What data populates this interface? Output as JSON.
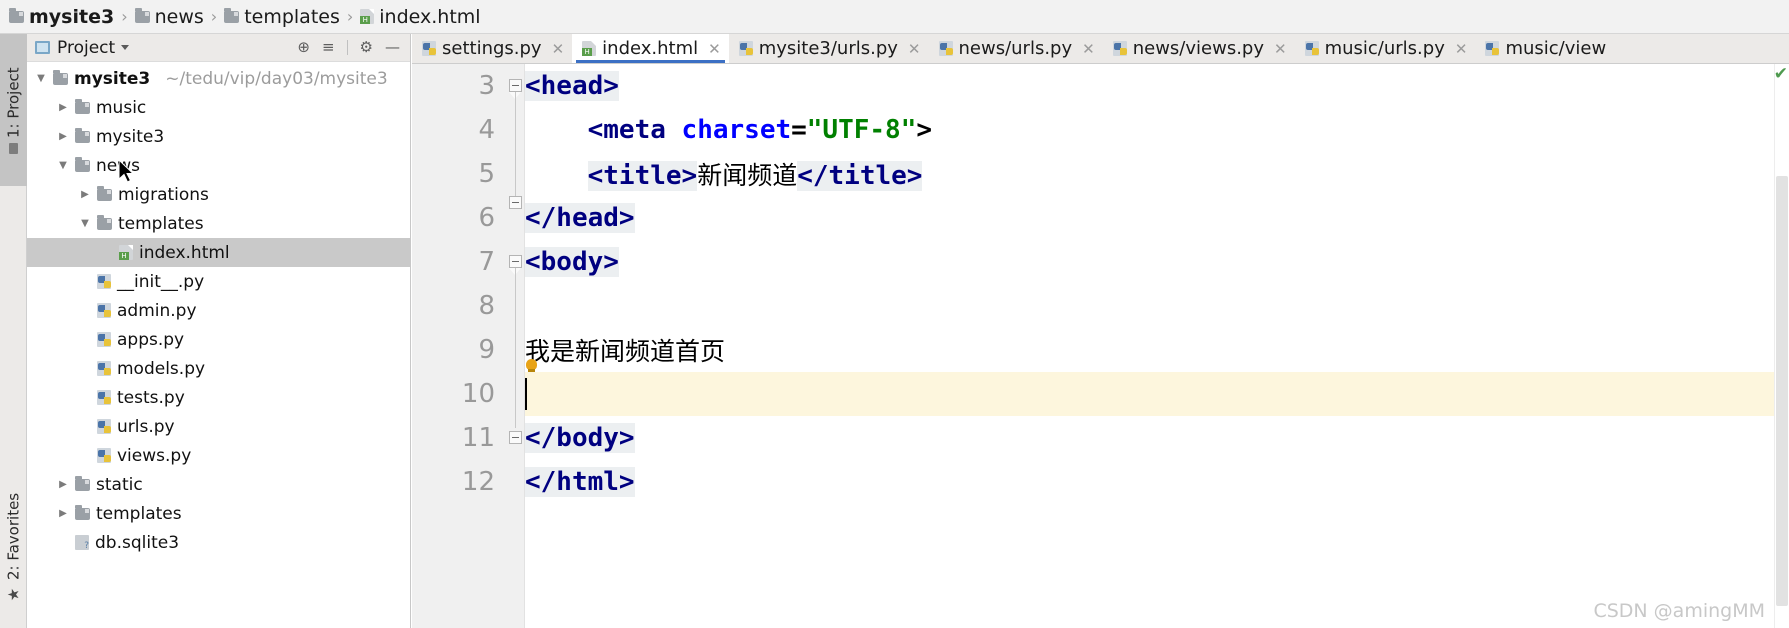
{
  "breadcrumb": {
    "items": [
      {
        "label": "mysite3",
        "icon": "folder-icon",
        "bold": true
      },
      {
        "label": "news",
        "icon": "folder-icon",
        "bold": false
      },
      {
        "label": "templates",
        "icon": "folder-icon",
        "bold": false
      },
      {
        "label": "index.html",
        "icon": "html-file-icon",
        "bold": false
      }
    ],
    "separator": "›"
  },
  "tool_strip": {
    "project_tab": "1: Project",
    "favorites_tab": "2: Favorites"
  },
  "project_panel": {
    "title": "Project",
    "actions": [
      {
        "name": "locate-icon",
        "glyph": "⊕"
      },
      {
        "name": "collapse-all-icon",
        "glyph": "≡"
      },
      {
        "name": "gear-icon",
        "glyph": "⚙"
      },
      {
        "name": "minimize-icon",
        "glyph": "—"
      }
    ],
    "tree": [
      {
        "label": "mysite3",
        "path": "~/tedu/vip/day03/mysite3",
        "icon": "folder-icon",
        "arrow": "expanded",
        "indent": 0,
        "bold": true,
        "selected": false
      },
      {
        "label": "music",
        "path": "",
        "icon": "folder-icon",
        "arrow": "collapsed",
        "indent": 1,
        "bold": false,
        "selected": false
      },
      {
        "label": "mysite3",
        "path": "",
        "icon": "folder-icon",
        "arrow": "collapsed",
        "indent": 1,
        "bold": false,
        "selected": false
      },
      {
        "label": "news",
        "path": "",
        "icon": "folder-icon",
        "arrow": "expanded",
        "indent": 1,
        "bold": false,
        "selected": false
      },
      {
        "label": "migrations",
        "path": "",
        "icon": "folder-icon",
        "arrow": "collapsed",
        "indent": 2,
        "bold": false,
        "selected": false
      },
      {
        "label": "templates",
        "path": "",
        "icon": "folder-icon",
        "arrow": "expanded",
        "indent": 2,
        "bold": false,
        "selected": false
      },
      {
        "label": "index.html",
        "path": "",
        "icon": "html-file-icon",
        "arrow": "none",
        "indent": 3,
        "bold": false,
        "selected": true
      },
      {
        "label": "__init__.py",
        "path": "",
        "icon": "python-file-icon",
        "arrow": "none",
        "indent": 2,
        "bold": false,
        "selected": false
      },
      {
        "label": "admin.py",
        "path": "",
        "icon": "python-file-icon",
        "arrow": "none",
        "indent": 2,
        "bold": false,
        "selected": false
      },
      {
        "label": "apps.py",
        "path": "",
        "icon": "python-file-icon",
        "arrow": "none",
        "indent": 2,
        "bold": false,
        "selected": false
      },
      {
        "label": "models.py",
        "path": "",
        "icon": "python-file-icon",
        "arrow": "none",
        "indent": 2,
        "bold": false,
        "selected": false
      },
      {
        "label": "tests.py",
        "path": "",
        "icon": "python-file-icon",
        "arrow": "none",
        "indent": 2,
        "bold": false,
        "selected": false
      },
      {
        "label": "urls.py",
        "path": "",
        "icon": "python-file-icon",
        "arrow": "none",
        "indent": 2,
        "bold": false,
        "selected": false
      },
      {
        "label": "views.py",
        "path": "",
        "icon": "python-file-icon",
        "arrow": "none",
        "indent": 2,
        "bold": false,
        "selected": false
      },
      {
        "label": "static",
        "path": "",
        "icon": "folder-icon",
        "arrow": "collapsed",
        "indent": 1,
        "bold": false,
        "selected": false
      },
      {
        "label": "templates",
        "path": "",
        "icon": "folder-icon",
        "arrow": "collapsed",
        "indent": 1,
        "bold": false,
        "selected": false
      },
      {
        "label": "db.sqlite3",
        "path": "",
        "icon": "sqlite-file-icon",
        "arrow": "none",
        "indent": 1,
        "bold": false,
        "selected": false
      }
    ]
  },
  "editor_tabs": [
    {
      "label": "settings.py",
      "icon": "python-file-icon",
      "active": false,
      "closable": true
    },
    {
      "label": "index.html",
      "icon": "html-file-icon",
      "active": true,
      "closable": true
    },
    {
      "label": "mysite3/urls.py",
      "icon": "python-file-icon",
      "active": false,
      "closable": true
    },
    {
      "label": "news/urls.py",
      "icon": "python-file-icon",
      "active": false,
      "closable": true
    },
    {
      "label": "news/views.py",
      "icon": "python-file-icon",
      "active": false,
      "closable": true
    },
    {
      "label": "music/urls.py",
      "icon": "python-file-icon",
      "active": false,
      "closable": true
    },
    {
      "label": "music/view",
      "icon": "python-file-icon",
      "active": false,
      "closable": false
    }
  ],
  "editor": {
    "first_visible_line": 3,
    "current_line": 10,
    "line_numbers": [
      "3",
      "4",
      "5",
      "6",
      "7",
      "8",
      "9",
      "10",
      "11",
      "12"
    ],
    "lines": {
      "l3": "<head>",
      "l4_open": "<meta ",
      "l4_attr": "charset",
      "l4_eq": "=",
      "l4_val": "\"UTF-8\"",
      "l4_close": ">",
      "l5_open": "<title>",
      "l5_text": "新闻频道",
      "l5_close": "</title>",
      "l6": "</head>",
      "l7": "<body>",
      "l8": "",
      "l9": "我是新闻频道首页",
      "l10": "",
      "l11": "</body>",
      "l12": "</html>"
    },
    "colors": {
      "tag": "#000080",
      "attribute": "#0000ff",
      "attribute_value": "#008000",
      "current_line_bg": "#fdf6dd",
      "token_highlight_bg": "#eceff1",
      "gutter_bg": "#f0f0f0",
      "line_number": "#999999",
      "selected_row_bg": "#c9c9c9"
    },
    "inspection_status": "✔"
  },
  "watermark": "CSDN @amingMM"
}
